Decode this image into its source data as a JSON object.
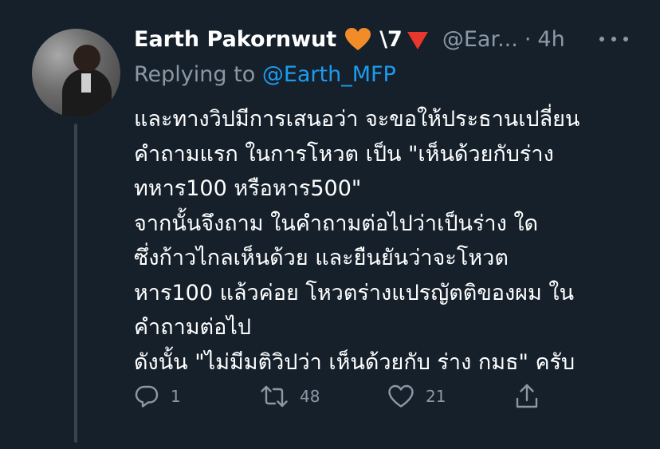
{
  "tweet": {
    "display_name": "Earth Pakornwut",
    "name_suffix": "\\7",
    "handle": "@Ear...",
    "separator": "·",
    "time": "4h",
    "reply_prefix": "Replying to",
    "reply_mention": "@Earth_MFP",
    "body_lines": [
      "และทางวิปมีการเสนอว่า จะขอให้ประธานเปลี่ยน",
      "คำถามแรก ในการโหวต เป็น \"เห็นด้วยกับร่าง",
      "ทหาร100 หรือหาร500\"",
      "จากนั้นจึงถาม ในคำถามต่อไปว่าเป็นร่าง ใด",
      "ซึ่งก้าวไกลเห็นด้วย และยืนยันว่าจะโหวต",
      "หาร100 แล้วค่อย โหวตร่างแปรญัตติของผม ใน",
      "คำถามต่อไป",
      "ดังนั้น \"ไม่มีมติวิปว่า เห็นด้วยกับ ร่าง กมธ\" ครับ"
    ]
  },
  "actions": {
    "reply_count": "1",
    "retweet_count": "48",
    "like_count": "21"
  },
  "icons": {
    "emoji_1": "orange-heart-icon",
    "emoji_2": "red-down-triangle-icon",
    "more": "more-dots-icon",
    "reply": "reply-icon",
    "retweet": "retweet-icon",
    "like": "heart-icon",
    "share": "share-icon"
  },
  "colors": {
    "background": "#15202b",
    "primary_text": "#ffffff",
    "secondary_text": "#8b98a5",
    "link": "#1d9bf0",
    "heart_emoji": "#f28c28",
    "triangle_emoji": "#e8372c"
  }
}
